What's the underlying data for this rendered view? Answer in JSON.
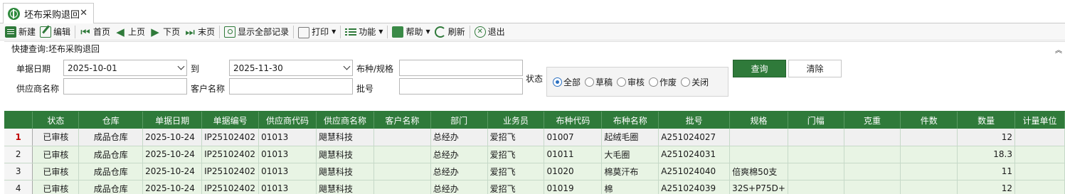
{
  "tab": {
    "title": "坯布采购退回",
    "close": "✕"
  },
  "toolbar": {
    "new": "新建",
    "edit": "编辑",
    "first": "首页",
    "prev": "上页",
    "next": "下页",
    "last": "末页",
    "show_all": "显示全部记录",
    "print": "打印",
    "func": "功能",
    "help": "帮助",
    "refresh": "刷新",
    "exit": "退出"
  },
  "query": {
    "title": "快捷查询:坯布采购退回",
    "date_label": "单据日期",
    "date_from": "2025-10-01",
    "to_label": "到",
    "date_to": "2025-11-30",
    "fabric_label": "布种/规格",
    "fabric_value": "",
    "supplier_label": "供应商名称",
    "supplier_value": "",
    "customer_label": "客户名称",
    "customer_value": "",
    "batch_label": "批号",
    "batch_value": "",
    "status_label": "状态",
    "status_options": [
      "全部",
      "草稿",
      "审核",
      "作废",
      "关闭"
    ],
    "status_selected": "全部",
    "query_btn": "查询",
    "clear_btn": "清除"
  },
  "grid": {
    "columns": [
      "",
      "状态",
      "仓库",
      "单据日期",
      "单据编号",
      "供应商代码",
      "供应商名称",
      "客户名称",
      "部门",
      "业务员",
      "布种代码",
      "布种名称",
      "批号",
      "规格",
      "门幅",
      "克重",
      "件数",
      "数量",
      "计量单位"
    ],
    "rows": [
      [
        "1",
        "已审核",
        "成品仓库",
        "2025-10-24",
        "IP25102402",
        "01013",
        "飓慧科技",
        "",
        "总经办",
        "爱招飞",
        "01007",
        "起绒毛圈",
        "A251024027",
        "",
        "",
        "",
        "",
        "12",
        ""
      ],
      [
        "2",
        "已审核",
        "成品仓库",
        "2025-10-24",
        "IP25102402",
        "01013",
        "飓慧科技",
        "",
        "总经办",
        "爱招飞",
        "01011",
        "大毛圈",
        "A251024031",
        "",
        "",
        "",
        "",
        "18.3",
        ""
      ],
      [
        "3",
        "已审核",
        "成品仓库",
        "2025-10-24",
        "IP25102402",
        "01013",
        "飓慧科技",
        "",
        "总经办",
        "爱招飞",
        "01020",
        "棉莫汗布",
        "A251024040",
        "倍爽棉50支",
        "",
        "",
        "",
        "11",
        ""
      ],
      [
        "4",
        "已审核",
        "成品仓库",
        "2025-10-24",
        "IP25102402",
        "01013",
        "飓慧科技",
        "",
        "总经办",
        "爱招飞",
        "01019",
        "棉",
        "A251024039",
        "32S+P75D+",
        "",
        "",
        "",
        "12",
        ""
      ]
    ]
  }
}
